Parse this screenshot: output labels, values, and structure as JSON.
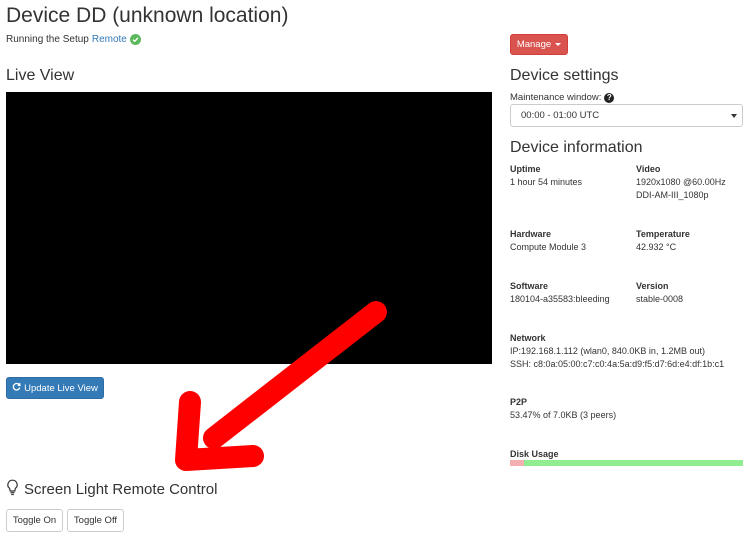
{
  "header": {
    "title": "Device DD (unknown location)",
    "status_prefix": "Running the Setup",
    "status_link": "Remote"
  },
  "manage": {
    "label": "Manage"
  },
  "live_view": {
    "title": "Live View",
    "update_button": "Update Live View"
  },
  "screen_light": {
    "title": "Screen Light Remote Control",
    "toggle_on": "Toggle On",
    "toggle_off": "Toggle Off"
  },
  "device_settings": {
    "title": "Device settings",
    "maintenance_label": "Maintenance window:",
    "maintenance_value": "00:00 - 01:00 UTC"
  },
  "device_info": {
    "title": "Device information",
    "uptime": {
      "label": "Uptime",
      "value": "1 hour 54 minutes"
    },
    "video": {
      "label": "Video",
      "value1": "1920x1080 @60.00Hz",
      "value2": "DDI-AM-III_1080p"
    },
    "hardware": {
      "label": "Hardware",
      "value": "Compute Module 3"
    },
    "temperature": {
      "label": "Temperature",
      "value": "42.932 °C"
    },
    "software": {
      "label": "Software",
      "value": "180104-a35583:bleeding"
    },
    "version": {
      "label": "Version",
      "value": "stable-0008"
    },
    "network": {
      "label": "Network",
      "ip": "IP:192.168.1.112 (wlan0, 840.0KB in, 1.2MB out)",
      "ssh": "SSH: c8:0a:05:00:c7:c0:4a:5a:d9:f5:d7:6d:e4:df:1b:c1"
    },
    "p2p": {
      "label": "P2P",
      "value": "53.47% of 7.0KB (3 peers)"
    },
    "disk_usage": {
      "label": "Disk Usage",
      "used_fraction": 0.06
    }
  },
  "colors": {
    "manage_button": "#d9534f",
    "primary_button": "#337ab7",
    "link": "#337ab7",
    "status_ok": "#5cb85c",
    "disk_free": "#90ee90",
    "disk_used": "#f4b0b0",
    "annotation_arrow": "#ff0000"
  },
  "icons": {
    "status": "check-circle-icon",
    "refresh": "refresh-icon",
    "help": "question-circle-icon",
    "light": "lightbulb-icon",
    "annotation": "red-arrow-annotation"
  }
}
